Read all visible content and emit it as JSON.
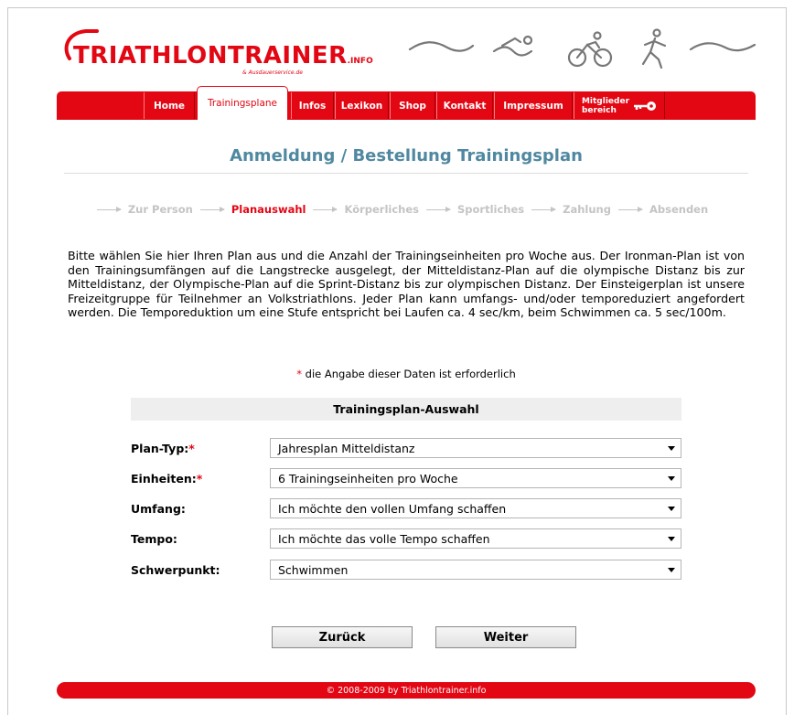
{
  "brand": {
    "logo_text": "TRIATHLONTRAINER",
    "logo_suffix": ".INFO",
    "logo_subline": "& Ausdauerservice.de",
    "accent_color": "#e30613",
    "title_color": "#4f88a0"
  },
  "nav": {
    "items": [
      {
        "label": "Home"
      },
      {
        "label": "Trainingsplane"
      },
      {
        "label": "Infos"
      },
      {
        "label": "Lexikon"
      },
      {
        "label": "Shop"
      },
      {
        "label": "Kontakt"
      },
      {
        "label": "Impressum"
      },
      {
        "label_line1": "Mitglieder",
        "label_line2": "bereich",
        "icon": "key-icon"
      }
    ],
    "active_index": 1
  },
  "page_title": "Anmeldung / Bestellung Trainingsplan",
  "steps": {
    "items": [
      "Zur Person",
      "Planauswahl",
      "Körperliches",
      "Sportliches",
      "Zahlung",
      "Absenden"
    ],
    "current_index": 1
  },
  "intro_text": "Bitte wählen Sie hier Ihren Plan aus und die Anzahl der Trainingseinheiten pro Woche aus. Der Ironman-Plan ist von den Trainingsumfängen auf die Langstrecke ausgelegt, der Mitteldistanz-Plan auf die olympische Distanz bis zur Mitteldistanz, der Olympische-Plan auf die Sprint-Distanz bis zur olympischen Distanz. Der Einsteigerplan ist unsere Freizeitgruppe für Teilnehmer an Volkstriathlons. Jeder Plan kann umfangs- und/oder temporeduziert angefordert werden. Die Temporeduktion um eine Stufe entspricht bei Laufen ca. 4 sec/km, beim Schwimmen ca. 5 sec/100m.",
  "required_note": {
    "star": "*",
    "text": " die Angabe dieser Daten ist erforderlich"
  },
  "section_title": "Trainingsplan-Auswahl",
  "form": {
    "plan_typ": {
      "label": "Plan-Typ:",
      "required": "*",
      "value": "Jahresplan Mitteldistanz"
    },
    "einheiten": {
      "label": "Einheiten:",
      "required": "*",
      "value": "6 Trainingseinheiten pro Woche"
    },
    "umfang": {
      "label": "Umfang:",
      "value": "Ich möchte den vollen Umfang schaffen"
    },
    "tempo": {
      "label": "Tempo:",
      "value": "Ich möchte das volle Tempo schaffen"
    },
    "schwerpunkt": {
      "label": "Schwerpunkt:",
      "value": "Schwimmen"
    }
  },
  "buttons": {
    "back": "Zurück",
    "next": "Weiter"
  },
  "footer": "© 2008-2009 by Triathlontrainer.info"
}
